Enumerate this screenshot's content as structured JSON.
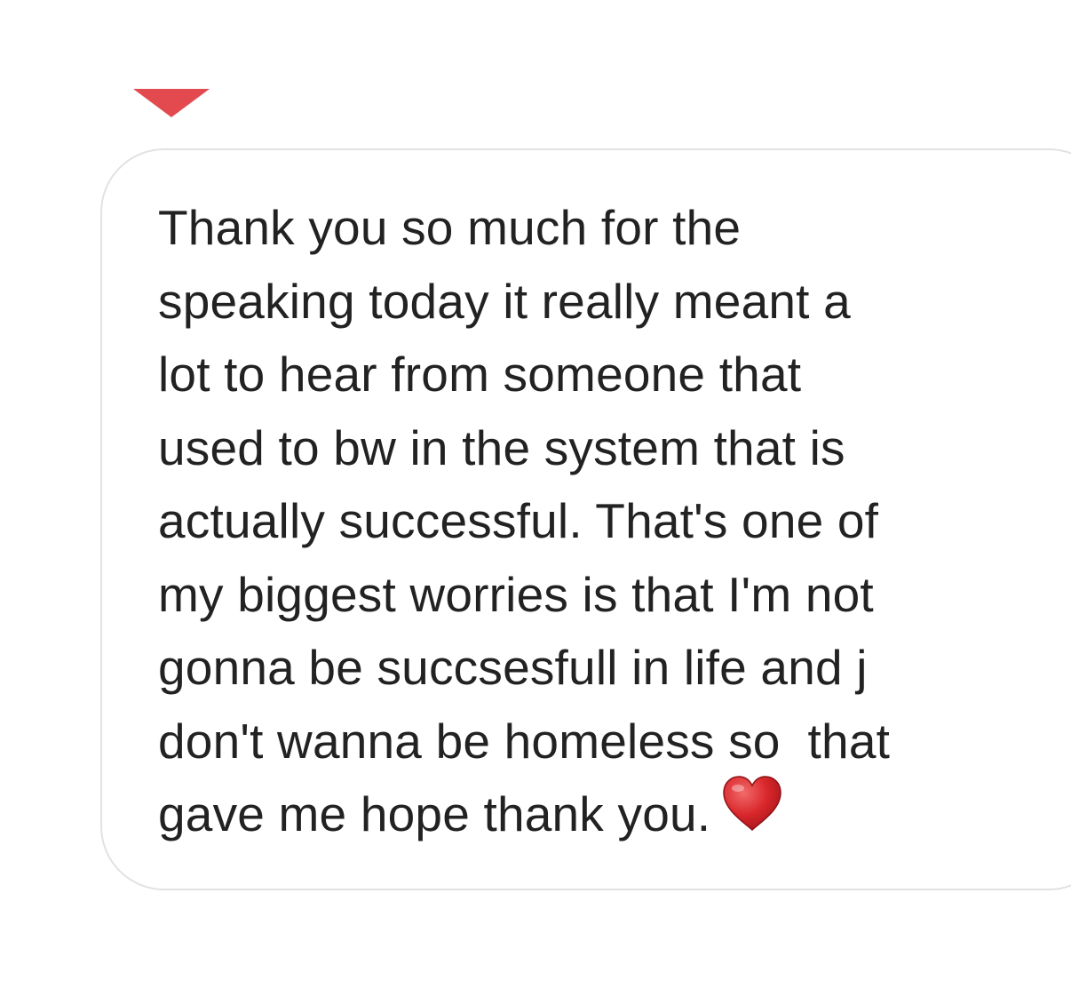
{
  "message": {
    "lines": [
      "Thank you so much for the",
      "speaking today it really meant a",
      "lot to hear from someone that",
      "used to bw in the system that is",
      "actually successful. That's one of",
      "my biggest worries is that I'm not",
      "gonna be succsesfull in life and j",
      "don't wanna be homeless so  that",
      "gave me hope thank you."
    ],
    "emoji": "heart-emoji"
  },
  "colors": {
    "caret": "#e34a50",
    "heart": "#d9282c",
    "text": "#222222",
    "bubble_border": "#e2e2e2"
  }
}
